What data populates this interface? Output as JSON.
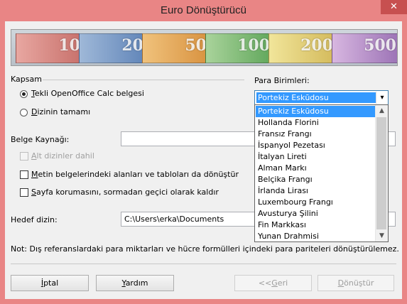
{
  "window": {
    "title": "Euro Dönüştürücü",
    "close_glyph": "✕"
  },
  "banner": {
    "notes": [
      "10",
      "20",
      "50",
      "100",
      "200",
      "500"
    ]
  },
  "scope": {
    "group_label": "Kapsam",
    "single_doc": {
      "mnemonic": "T",
      "rest": "ekli OpenOffice Calc belgesi",
      "selected": true
    },
    "directory": {
      "mnemonic": "D",
      "rest": "izinin tamamı",
      "selected": false
    }
  },
  "currencies": {
    "label": "Para Birimleri:",
    "selected": "Portekiz Eskūdosu",
    "arrow_glyph": "▾",
    "options": [
      "Portekiz Eskūdosu",
      "Hollanda Florini",
      "Fransız Frangı",
      "İspanyol Pezetası",
      "İtalyan Lireti",
      "Alman Markı",
      "Belçika Frangı",
      "İrlanda Lirası",
      "Luxembourg Frangı",
      "Avusturya Şilini",
      "Fin Markkası",
      "Yunan Drahmisi"
    ],
    "scroll_up": "▲",
    "scroll_down": "▼"
  },
  "source": {
    "label": "Belge Kaynağı:",
    "value": ""
  },
  "options": {
    "subdirs": {
      "mnemonic": "A",
      "rest": "lt dizinler dahil",
      "checked": false,
      "disabled": true
    },
    "fields": {
      "mnemonic": "M",
      "rest": "etin belgelerindeki alanları ve tabloları da dönüştür",
      "checked": false
    },
    "protection": {
      "mnemonic": "S",
      "rest": "ayfa korumasını, sormadan geçici olarak kaldır",
      "checked": false
    }
  },
  "target": {
    "label": "Hedef dizin:",
    "value": "C:\\Users\\erka\\Documents"
  },
  "note_text": "Not: Dış referanslardaki para miktarları ve hücre formülleri içindeki para pariteleri dönüştürülemez.",
  "buttons": {
    "cancel": {
      "mnemonic": "İ",
      "rest": "ptal"
    },
    "help": {
      "mnemonic": "Y",
      "rest": "ardım"
    },
    "back": {
      "prefix": "<<",
      "mnemonic": "G",
      "rest": "eri"
    },
    "convert": {
      "mnemonic": "D",
      "rest": "önüştür"
    }
  },
  "colors": {
    "title_bar": "#e98585",
    "close_button": "#c75050",
    "selection": "#3399ff"
  }
}
